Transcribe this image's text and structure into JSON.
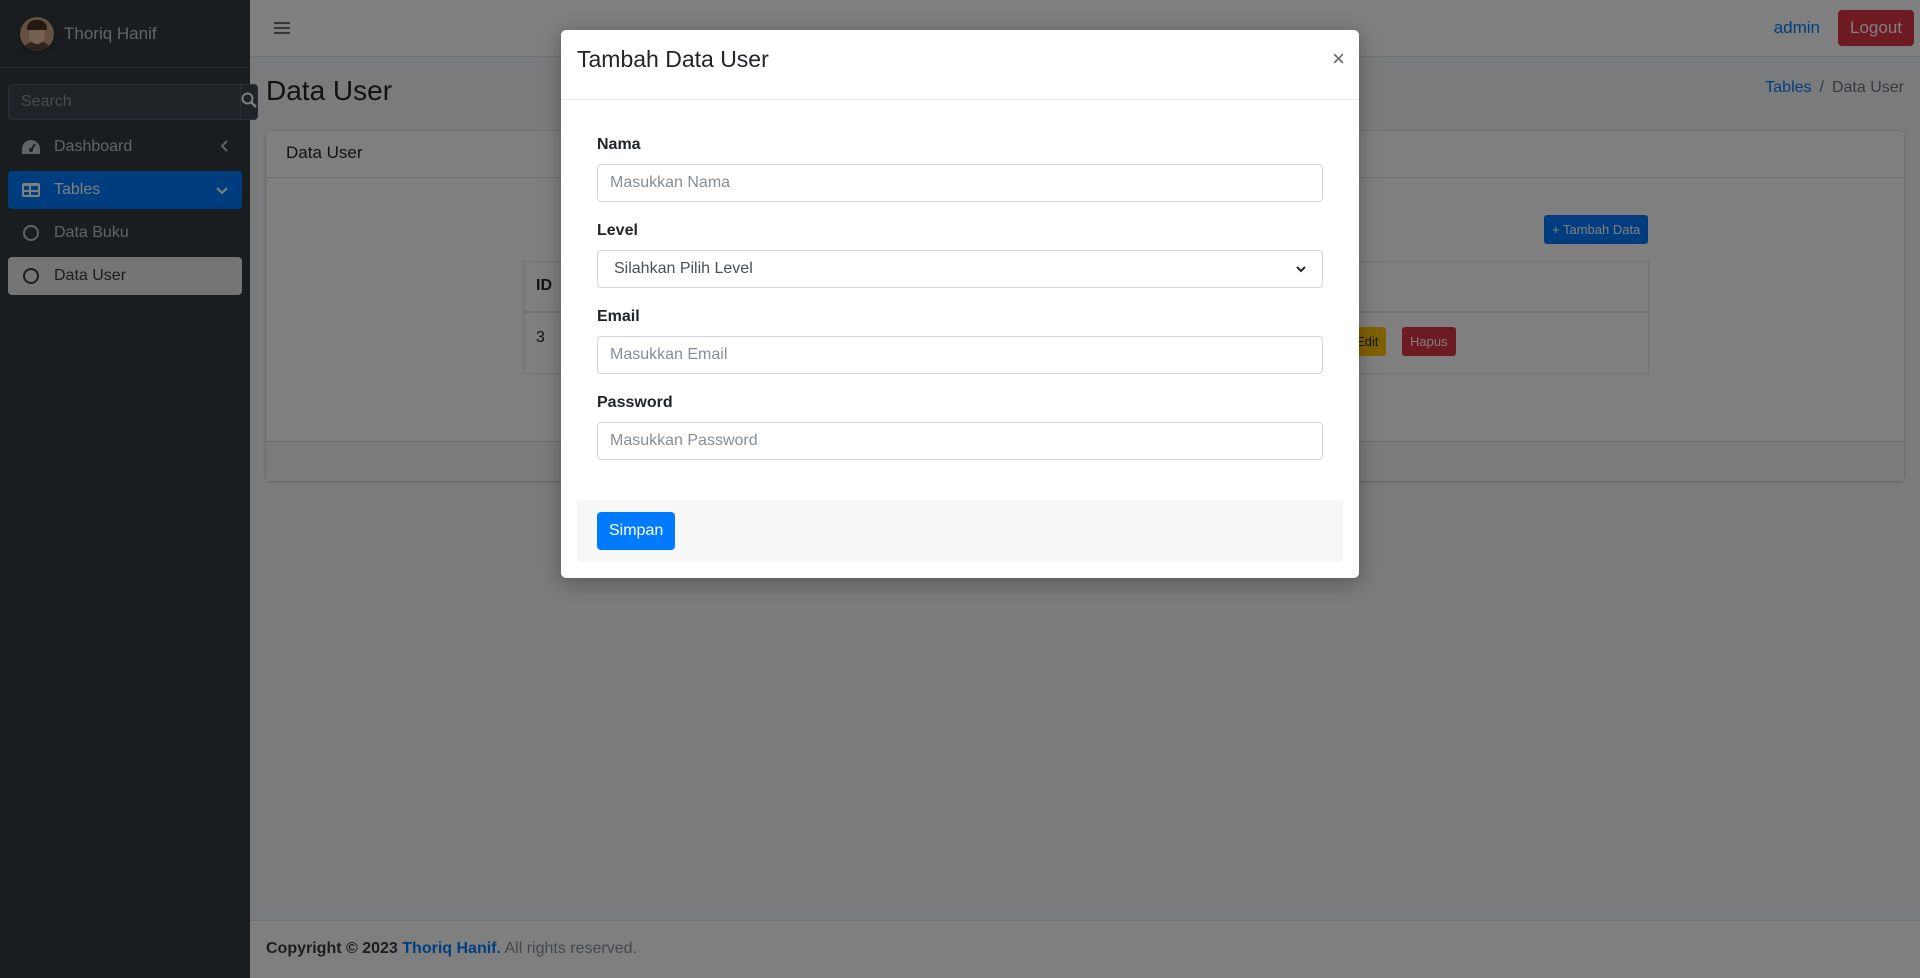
{
  "sidebar": {
    "brand_name": "Thoriq Hanif",
    "search_placeholder": "Search",
    "items": [
      {
        "label": "Dashboard",
        "icon": "dashboard-icon"
      },
      {
        "label": "Tables",
        "icon": "table-icon"
      },
      {
        "label": "Data Buku",
        "icon": "circle-icon"
      },
      {
        "label": "Data User",
        "icon": "circle-icon"
      }
    ]
  },
  "topbar": {
    "user": "admin",
    "logout_label": "Logout"
  },
  "page": {
    "title": "Data User",
    "breadcrumb": {
      "parent": "Tables",
      "current": "Data User"
    }
  },
  "card": {
    "title": "Data User",
    "add_button": "+ Tambah Data",
    "table": {
      "header_first": "ID",
      "rows": [
        {
          "id": "3"
        }
      ],
      "edit_label": "Edit",
      "delete_label": "Hapus"
    }
  },
  "footer": {
    "prefix": "Copyright © 2023",
    "author": "Thoriq Hanif.",
    "suffix": "All rights reserved."
  },
  "modal": {
    "title": "Tambah Data User",
    "close": "×",
    "fields": {
      "nama": {
        "label": "Nama",
        "placeholder": "Masukkan Nama"
      },
      "level": {
        "label": "Level",
        "selected": "Silahkan Pilih Level"
      },
      "email": {
        "label": "Email",
        "placeholder": "Masukkan Email"
      },
      "password": {
        "label": "Password",
        "placeholder": "Masukkan Password"
      }
    },
    "submit_label": "Simpan"
  },
  "colors": {
    "primary": "#007bff",
    "danger": "#dc3545",
    "warning": "#ffc107",
    "sidebar_bg": "#343a40"
  }
}
